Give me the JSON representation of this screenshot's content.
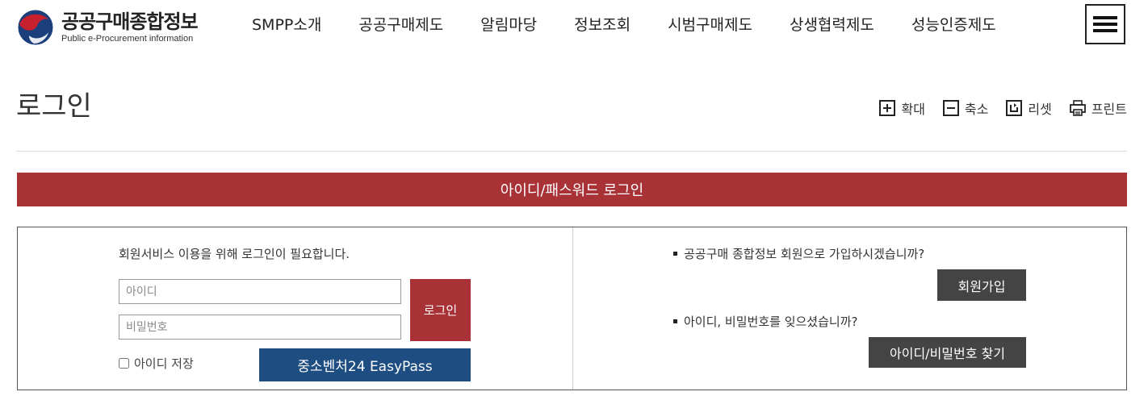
{
  "header": {
    "logo": {
      "title": "공공구매종합정보",
      "subtitle": "Public e-Procurement information"
    },
    "nav": [
      {
        "label": "SMPP소개"
      },
      {
        "label": "공공구매제도"
      },
      {
        "label": "알림마당"
      },
      {
        "label": "정보조회"
      },
      {
        "label": "시범구매제도"
      },
      {
        "label": "상생협력제도"
      },
      {
        "label": "성능인증제도"
      }
    ],
    "menu_icon": "hamburger-icon"
  },
  "page": {
    "title": "로그인",
    "tools": [
      {
        "label": "확대",
        "icon": "zoom-in-icon"
      },
      {
        "label": "축소",
        "icon": "zoom-out-icon"
      },
      {
        "label": "리셋",
        "icon": "reset-icon"
      },
      {
        "label": "프린트",
        "icon": "print-icon"
      }
    ]
  },
  "login": {
    "bar_title": "아이디/패스워드 로그인",
    "notice": "회원서비스 이용을 위해 로그인이 필요합니다.",
    "id_placeholder": "아이디",
    "pw_placeholder": "비밀번호",
    "login_button": "로그인",
    "save_id_label": "아이디 저장",
    "easypass_button": "중소벤처24 EasyPass",
    "join_question": "공공구매 종합정보 회원으로 가입하시겠습니까?",
    "join_button": "회원가입",
    "find_question": "아이디, 비밀번호를 잊으셨습니까?",
    "find_button": "아이디/비밀번호 찾기"
  },
  "colors": {
    "accent_red": "#a93237",
    "easypass_blue": "#1e4d82",
    "dark_button": "#444444"
  }
}
